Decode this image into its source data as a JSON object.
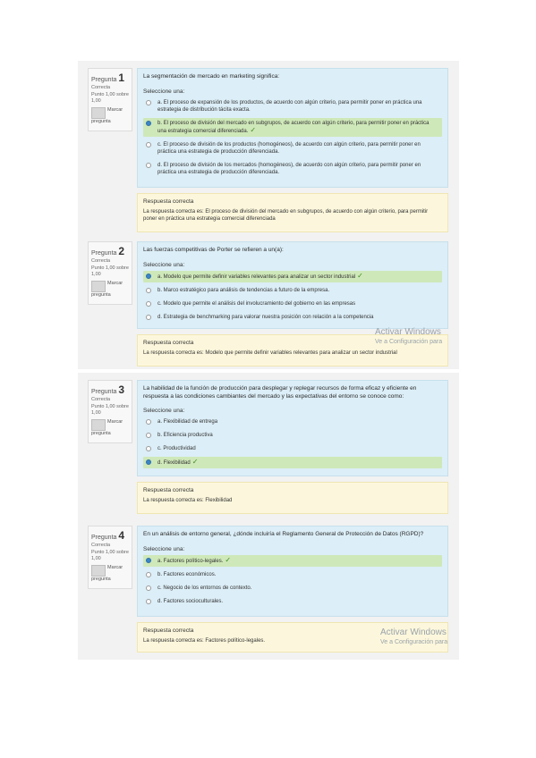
{
  "questions": [
    {
      "label": "Pregunta",
      "number": "1",
      "state": "Correcta",
      "grade": "Punto 1,00 sobre 1,00",
      "flag": "Marcar pregunta",
      "text": "La segmentación de mercado en marketing significa:",
      "prompt": "Seleccione una:",
      "options": [
        "a. El proceso de expansión de los productos, de acuerdo con algún criterio, para permitir poner en práctica una estrategia de distribución tácita exacta.",
        "b. El proceso de división del mercado en subgrupos, de acuerdo con algún criterio, para permitir poner en práctica una estrategia comercial diferenciada.",
        "c. El proceso de división de los productos (homogéneos), de acuerdo con algún criterio, para permitir poner en práctica una estrategia de producción diferenciada.",
        "d. El proceso de división de los mercados (homogéneos), de acuerdo con algún criterio, para permitir poner en práctica una estrategia de producción diferenciada."
      ],
      "feedback_title": "Respuesta correcta",
      "feedback_text": "La respuesta correcta es: El proceso de división del mercado en subgrupos, de acuerdo con algún criterio, para permitir poner en práctica una estrategia comercial diferenciada"
    },
    {
      "label": "Pregunta",
      "number": "2",
      "state": "Correcta",
      "grade": "Punto 1,00 sobre 1,00",
      "flag": "Marcar pregunta",
      "text": "Las fuerzas competitivas de Porter se refieren a un(a):",
      "prompt": "Seleccione una:",
      "options": [
        "a. Modelo que permite definir variables relevantes para analizar un sector industrial",
        "b. Marco estratégico para análisis de tendencias a futuro de la empresa.",
        "c. Modelo que permite el análisis del involucramiento del gobierno en las empresas",
        "d. Estrategia de benchmarking para valorar nuestra posición con relación a la competencia"
      ],
      "feedback_title": "Respuesta correcta",
      "feedback_text": "La respuesta correcta es: Modelo que permite definir variables relevantes para analizar un sector industrial"
    },
    {
      "label": "Pregunta",
      "number": "3",
      "state": "Correcta",
      "grade": "Punto 1,00 sobre 1,00",
      "flag": "Marcar pregunta",
      "text": "La habilidad de la función de producción para desplegar y replegar recursos de forma eficaz y eficiente en respuesta a las condiciones cambiantes del mercado y las expectativas del entorno se conoce como:",
      "prompt": "Seleccione una:",
      "options": [
        "a. Flexibilidad de entrega",
        "b. Eficiencia productiva",
        "c. Productividad",
        "d. Flexibilidad"
      ],
      "feedback_title": "Respuesta correcta",
      "feedback_text": "La respuesta correcta es: Flexibilidad"
    },
    {
      "label": "Pregunta",
      "number": "4",
      "state": "Correcta",
      "grade": "Punto 1,00 sobre 1,00",
      "flag": "Marcar pregunta",
      "text": "En un análisis de entorno general, ¿dónde incluiría el Reglamento General de Protección de Datos (RGPD)?",
      "prompt": "Seleccione una:",
      "options": [
        "a. Factores político-legales.",
        "b. Factores económicos.",
        "c. Negocio de los entornos de contexto.",
        "d. Factores socioculturales."
      ],
      "feedback_title": "Respuesta correcta",
      "feedback_text": "La respuesta correcta es: Factores político-legales."
    }
  ],
  "watermark": {
    "title": "Activar Windows",
    "subtitle": "Ve a Configuración para"
  }
}
